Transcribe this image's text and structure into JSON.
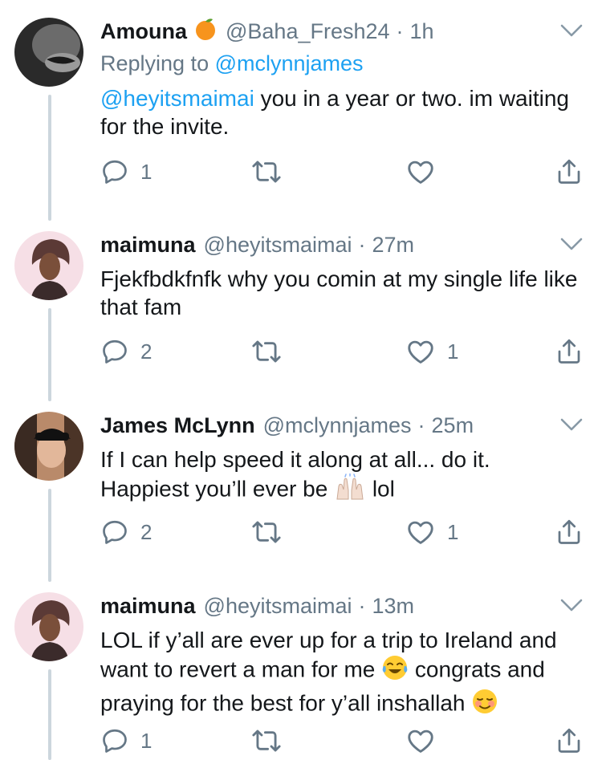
{
  "tweets": [
    {
      "name": "Amouna",
      "handle": "@Baha_Fresh24",
      "time": "1h",
      "replying_prefix": "Replying to ",
      "replying_to": "@mclynnjames",
      "mention": "@heyitsmaimai",
      "text": " you in a year or two. im waiting for the invite.",
      "replies": "1",
      "retweets": "",
      "likes": ""
    },
    {
      "name": "maimuna",
      "handle": "@heyitsmaimai",
      "time": "27m",
      "text": "Fjekfbdkfnfk why you comin at my single life like that fam",
      "replies": "2",
      "retweets": "",
      "likes": "1"
    },
    {
      "name": "James McLynn",
      "handle": "@mclynnjames",
      "time": "25m",
      "text_line1": "If I can help speed it along at all... do it.",
      "text_line2a": "Happiest you’ll ever be ",
      "text_line2b": " lol",
      "replies": "2",
      "retweets": "",
      "likes": "1"
    },
    {
      "name": "maimuna",
      "handle": "@heyitsmaimai",
      "time": "13m",
      "text_a": "LOL if y’all are ever up for a trip to Ireland and want to revert a man for me ",
      "text_b": " congrats and praying for the best for y’all inshallah ",
      "replies": "1",
      "retweets": "",
      "likes": ""
    }
  ],
  "dot": "·",
  "icons": {
    "reply": "reply-icon",
    "retweet": "retweet-icon",
    "like": "heart-icon",
    "share": "share-icon",
    "caret": "chevron-down-icon"
  },
  "colors": {
    "text": "#14171a",
    "muted": "#657786",
    "link": "#1da1f2",
    "thread_line": "#ccd6dd"
  }
}
